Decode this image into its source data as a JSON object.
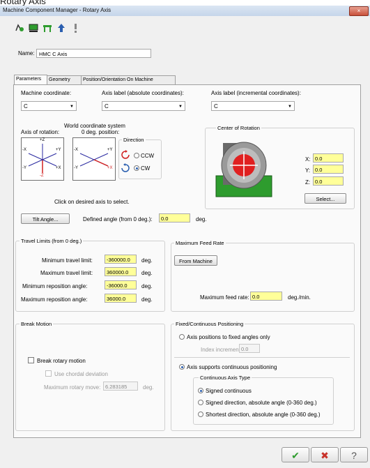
{
  "page_heading": "Rotary Axis",
  "window": {
    "title": "Machine Component Manager - Rotary Axis",
    "close_glyph": "×"
  },
  "toolbar": {
    "icons": [
      "rotary-axis-icon",
      "linear-axis-icon",
      "component-icon",
      "blue-arrow-icon",
      "info-icon"
    ]
  },
  "name": {
    "label": "Name:",
    "value": "HMC C Axis"
  },
  "tabs": [
    "Parameters",
    "Geometry",
    "Position/Orientation On Machine"
  ],
  "coords": {
    "machine_label": "Machine coordinate:",
    "machine_value": "C",
    "abs_label": "Axis label (absolute coordinates):",
    "abs_value": "C",
    "inc_label": "Axis label (incremental coordinates):",
    "inc_value": "C"
  },
  "world": {
    "title": "World coordinate system",
    "axis_of_rotation": "Axis of rotation:",
    "zero_deg": "0 deg. position:",
    "hint": "Click on desired axis to select.",
    "axis_labels": {
      "pz": "+Z",
      "mz": "-Z",
      "px": "+X",
      "mx": "-X",
      "py": "+Y",
      "my": "-Y"
    },
    "direction_title": "Direction",
    "ccw": "CCW",
    "cw": "CW",
    "tilt_button": "Tilt Angle...",
    "defined_angle_label": "Defined angle (from 0 deg.):",
    "defined_angle_value": "0.0",
    "deg": "deg."
  },
  "center": {
    "title": "Center of Rotation",
    "x_label": "X:",
    "x_value": "0.0",
    "y_label": "Y:",
    "y_value": "0.0",
    "z_label": "Z:",
    "z_value": "0.0",
    "select_button": "Select..."
  },
  "travel": {
    "title": "Travel Limits (from 0 deg.)",
    "min_label": "Minimum travel limit:",
    "min_value": "-360000.0",
    "max_label": "Maximum travel limit:",
    "max_value": "360000.0",
    "min_repo_label": "Minimum reposition angle:",
    "min_repo_value": "-36000.0",
    "max_repo_label": "Maximum reposition angle:",
    "max_repo_value": "36000.0",
    "unit": "deg."
  },
  "feed": {
    "title": "Maximum Feed Rate",
    "from_machine": "From Machine",
    "label": "Maximum feed rate:",
    "value": "0.0",
    "unit": "deg./min."
  },
  "break": {
    "title": "Break Motion",
    "break_rotary": "Break rotary motion",
    "chordal": "Use chordal deviation",
    "max_move_label": "Maximum rotary move:",
    "max_move_value": "6.283185",
    "unit": "deg."
  },
  "positioning": {
    "title": "Fixed/Continuous Positioning",
    "fixed": "Axis positions to fixed angles only",
    "index_label": "Index increment:",
    "index_value": "0.0",
    "continuous": "Axis supports continuous positioning",
    "type_title": "Continuous Axis Type",
    "signed": "Signed continuous",
    "signed_dir": "Signed direction, absolute angle (0-360 deg.)",
    "shortest": "Shortest direction, absolute angle (0-360 deg.)"
  },
  "footer": {
    "ok": "✔",
    "cancel": "✖",
    "help": "?"
  },
  "colors": {
    "accent": "#2a5fb0",
    "field_yellow": "#ffff99",
    "ok_green": "#2e9c2e",
    "cancel_red": "#c8322a"
  }
}
